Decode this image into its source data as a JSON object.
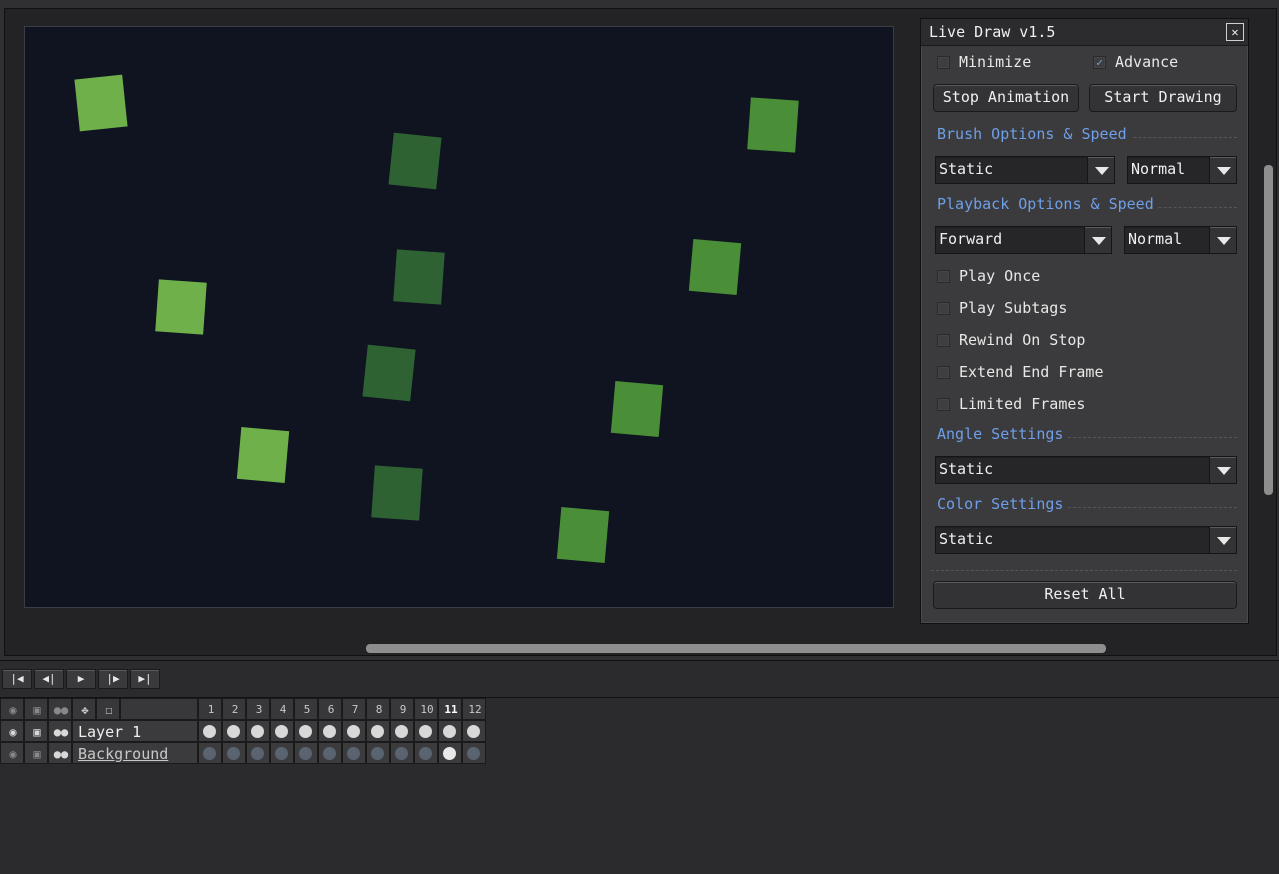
{
  "dialog": {
    "title": "Live Draw v1.5",
    "minimize_label": "Minimize",
    "minimize_checked": false,
    "advance_label": "Advance",
    "advance_checked": true,
    "stop_animation_label": "Stop Animation",
    "start_drawing_label": "Start Drawing",
    "brush_section": "Brush Options & Speed",
    "brush_type": "Static",
    "brush_speed": "Normal",
    "playback_section": "Playback Options & Speed",
    "playback_direction": "Forward",
    "playback_speed": "Normal",
    "play_once_label": "Play Once",
    "play_subtags_label": "Play Subtags",
    "rewind_on_stop_label": "Rewind On Stop",
    "extend_end_frame_label": "Extend End Frame",
    "limited_frames_label": "Limited Frames",
    "angle_section": "Angle Settings",
    "angle_value": "Static",
    "color_section": "Color Settings",
    "color_value": "Static",
    "reset_all_label": "Reset All",
    "check_mark": "✓"
  },
  "timeline": {
    "frames": [
      "1",
      "2",
      "3",
      "4",
      "5",
      "6",
      "7",
      "8",
      "9",
      "10",
      "11",
      "12"
    ],
    "active_frame": "11",
    "layers": [
      {
        "name": "Layer 1",
        "underlined": false
      },
      {
        "name": "Background",
        "underlined": true
      }
    ]
  },
  "colors": {
    "canvas_bg": "#0f1420",
    "square_light": "#6fb04a",
    "square_mid": "#4a8f37",
    "square_dark": "#2e6233",
    "accent_blue": "#6f9fe8"
  },
  "icons": {
    "close": "close-icon",
    "eye": "eye-icon",
    "lock": "lock-icon",
    "link": "link-icon",
    "first_frame": "first-frame-icon",
    "prev_frame": "prev-frame-icon",
    "play": "play-icon",
    "next_frame": "next-frame-icon",
    "last_frame": "last-frame-icon"
  }
}
